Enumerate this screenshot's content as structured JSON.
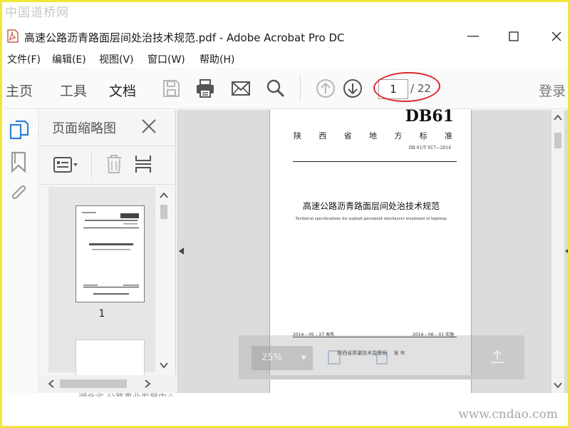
{
  "watermark": {
    "top": "中国道桥网",
    "bottom": "www.cndao.com"
  },
  "window": {
    "title": "高速公路沥青路面层间处治技术规范.pdf - Adobe Acrobat Pro DC",
    "minimize_glyph": "—",
    "maximize_glyph": "☐",
    "close_glyph": "✕"
  },
  "menu": [
    "文件(F)",
    "编辑(E)",
    "视图(V)",
    "窗口(W)",
    "帮助(H)"
  ],
  "toolbar": {
    "tabs": [
      "主页",
      "工具",
      "文档"
    ],
    "active_tab": "文档",
    "icons": [
      "save-icon",
      "print-icon",
      "email-icon",
      "search-icon",
      "page-up-icon",
      "page-down-icon"
    ],
    "page_current": "1",
    "page_total": "/ 22",
    "login": "登录"
  },
  "sidebar": {
    "icons": [
      "page-thumbnails-icon",
      "bookmarks-icon",
      "attachments-icon"
    ]
  },
  "thumb_panel": {
    "title": "页面缩略图",
    "thumb_number": "1"
  },
  "document": {
    "code": "DB61",
    "province": [
      "陕",
      "西",
      "省",
      "地",
      "方",
      "标",
      "准"
    ],
    "standard_no": "DB 61/T 917—2014",
    "title_cn": "高速公路沥青路面层间处治技术规范",
    "title_en": "Technical specifications for asphalt pavement interlayers treatment of highway",
    "publish_date": "2014 – 05 – 27 发布",
    "effective_date": "2014 – 06 – 01 实施",
    "publisher": "陕西省质量技术监督局　 发 布"
  },
  "float_toolbar": {
    "zoom": "25%"
  },
  "bottom_cut_text": "…湖北省·公路事业发展中心…",
  "colors": {
    "frame": "#f2e63a",
    "highlight_oval": "#e0262a",
    "sidebar_icon": "#2f7fd6"
  }
}
